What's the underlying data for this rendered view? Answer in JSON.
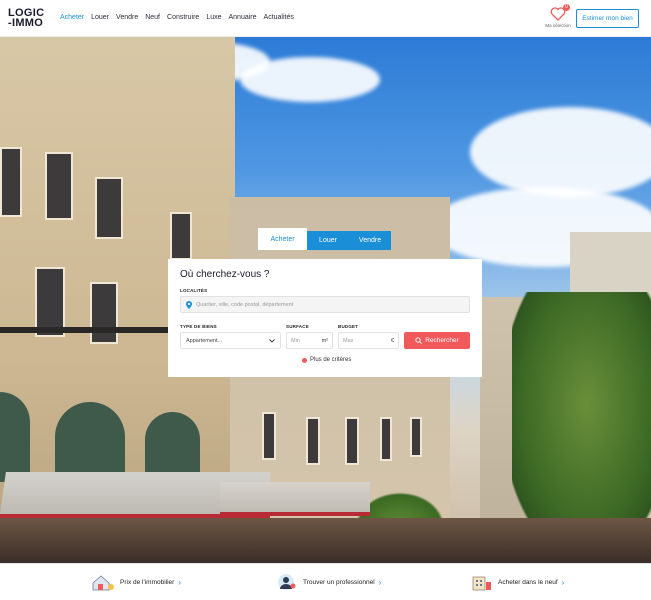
{
  "header": {
    "logo_line1": "LOGIC",
    "logo_line2": "-IMMO",
    "nav": [
      "Acheter",
      "Louer",
      "Vendre",
      "Neuf",
      "Construire",
      "Luxe",
      "Annuaire",
      "Actualités"
    ],
    "favorites_count": "0",
    "favorites_label": "Ma sélection",
    "estimate_label": "Estimer mon bien"
  },
  "search": {
    "tabs": [
      "Acheter",
      "Louer",
      "Vendre"
    ],
    "title": "Où cherchez-vous ?",
    "location_label": "LOCALITÉS",
    "location_placeholder": "Quartier, ville, code postal, département",
    "type_label": "TYPE DE BIENS",
    "type_value": "Appartement...",
    "surface_label": "SURFACE",
    "surface_placeholder": "Min",
    "surface_unit": "m²",
    "budget_label": "BUDGET",
    "budget_placeholder": "Max",
    "budget_unit": "€",
    "submit_label": "Rechercher",
    "more_criteria": "Plus de critères"
  },
  "footer": {
    "items": [
      "Prix de l'immobilier",
      "Trouver un professionnel",
      "Acheter dans le neuf"
    ]
  },
  "colors": {
    "accent": "#1a8fd8",
    "cta": "#f15a5a"
  }
}
